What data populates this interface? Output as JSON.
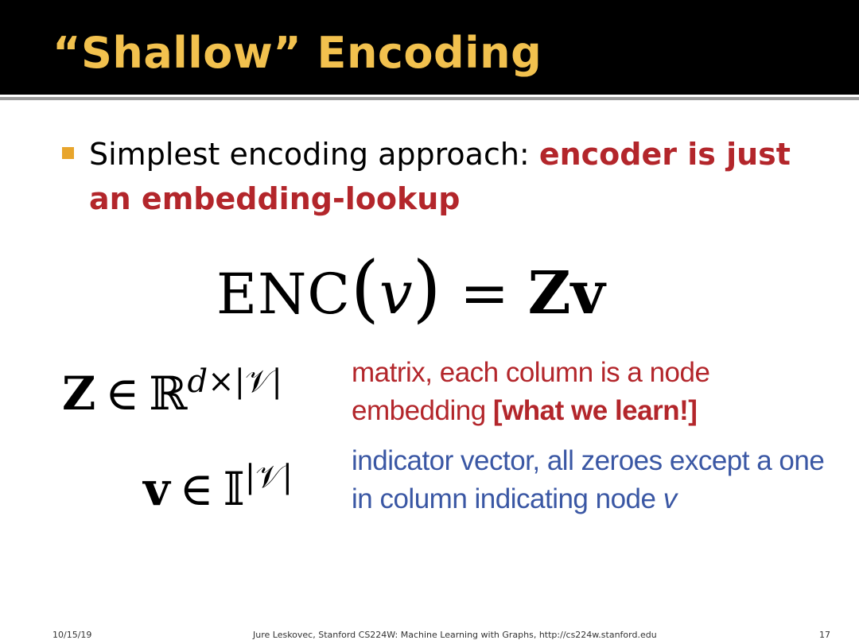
{
  "slide": {
    "title": "“Shallow” Encoding",
    "bullet": {
      "plain": "Simplest encoding approach: ",
      "highlight": "encoder is just an embedding-lookup"
    },
    "equation": {
      "enc": "ENC",
      "open_paren": "(",
      "var": "v",
      "close_paren": ")",
      "equals": " = ",
      "rhs": "Zv"
    },
    "definitions": [
      {
        "symbol": "Z",
        "relation": "∈",
        "space": "ℝ",
        "exponent_var": "d",
        "exponent_rest": "×|𝒱|",
        "description": "matrix, each column is a node embedding ",
        "description_emphasis": "[what we learn!]"
      },
      {
        "symbol": "v",
        "relation": "∈",
        "space": "𝕀",
        "exponent": "|𝒱|",
        "description": "indicator vector, all zeroes except a one in column indicating node ",
        "description_var": "v"
      }
    ],
    "footer": {
      "date": "10/15/19",
      "credit": "Jure Leskovec, Stanford CS224W: Machine Learning with Graphs, http://cs224w.stanford.edu",
      "page": "17"
    }
  },
  "colors": {
    "title_bar": "#000000",
    "title_text": "#f2c14e",
    "bullet_marker": "#e8a52c",
    "highlight_red": "#b3262b",
    "indicator_blue": "#3a57a4"
  }
}
